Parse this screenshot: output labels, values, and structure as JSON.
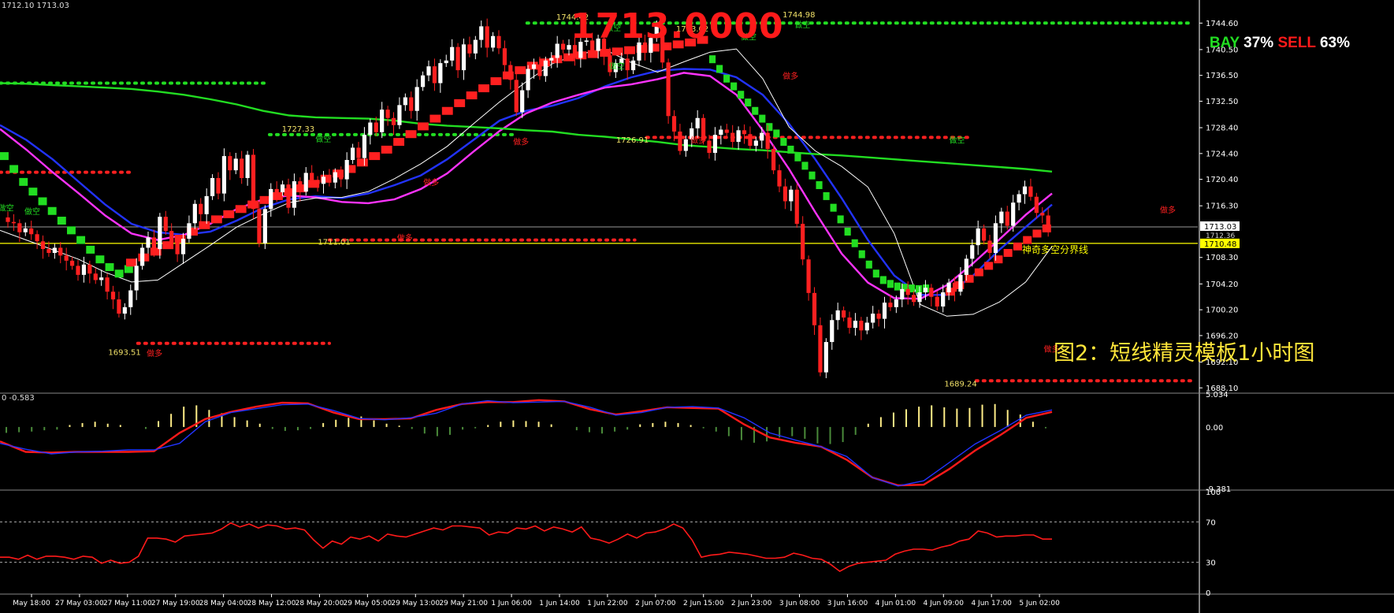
{
  "header": {
    "ohlc_text": "1712.10 1713.03",
    "big_price": "1713.0000",
    "sentiment": {
      "buy_label": "BAY",
      "buy_pct": "37%",
      "sell_label": "SELL",
      "sell_pct": "63%"
    },
    "caption": "图2：短线精灵模板1小时图"
  },
  "colors": {
    "background": "#000000",
    "axis": "#ffffff",
    "up_candle": "#ffffff",
    "down_candle": "#ff2020",
    "green_dots": "#22dd22",
    "red_dots": "#ff2020",
    "ma_blue": "#2233ff",
    "ma_magenta": "#ff33ff",
    "ma_green": "#22dd22",
    "price_line": "#ffff00",
    "macd_red": "#ff1a1a",
    "rsi_red": "#ff1a1a"
  },
  "chart_data": [
    {
      "type": "candlestick",
      "panel": "price",
      "y_ticks": [
        "1744.60",
        "1740.50",
        "1736.50",
        "1732.50",
        "1728.40",
        "1724.40",
        "1720.40",
        "1716.30",
        "1708.30",
        "1704.20",
        "1700.20",
        "1696.20",
        "1692.10",
        "1688.10"
      ],
      "ylim": [
        1687.4,
        1747.2
      ],
      "current_price_tag": "1713.03",
      "bid_tag": "1712.36",
      "line_price_tag": "1710.48",
      "line_price": 1710.48,
      "trend_label": "神奇多空分界线",
      "grid": false,
      "x_ticks": [
        "May 18:00",
        "27 May 03:00",
        "27 May 11:00",
        "27 May 19:00",
        "28 May 04:00",
        "28 May 12:00",
        "28 May 20:00",
        "29 May 05:00",
        "29 May 13:00",
        "29 May 21:00",
        "1 Jun 06:00",
        "1 Jun 14:00",
        "1 Jun 22:00",
        "2 Jun 07:00",
        "2 Jun 15:00",
        "2 Jun 23:00",
        "3 Jun 08:00",
        "3 Jun 16:00",
        "4 Jun 01:00",
        "4 Jun 09:00",
        "4 Jun 17:00",
        "5 Jun 02:00"
      ],
      "close_path": [
        1714.5,
        1713.8,
        1713.6,
        1712.2,
        1712.8,
        1711.9,
        1710.8,
        1709.6,
        1709.0,
        1709.8,
        1708.6,
        1707.8,
        1707.0,
        1705.6,
        1707.2,
        1705.8,
        1704.8,
        1705.2,
        1703.0,
        1701.8,
        1699.6,
        1700.6,
        1703.2,
        1707.0,
        1709.8,
        1711.4,
        1709.6,
        1714.6,
        1712.4,
        1710.6,
        1708.8,
        1711.2,
        1713.6,
        1716.6,
        1715.0,
        1717.8,
        1720.6,
        1718.2,
        1724.0,
        1721.8,
        1723.6,
        1720.6,
        1724.2,
        1715.8,
        1710.5,
        1715.8,
        1718.9,
        1718.4,
        1719.6,
        1716.0,
        1720.1,
        1718.5,
        1721.4,
        1720.3,
        1719.7,
        1720.8,
        1719.9,
        1721.5,
        1720.4,
        1723.4,
        1725.3,
        1723.7,
        1727.3,
        1729.2,
        1727.7,
        1731.2,
        1729.9,
        1728.8,
        1731.9,
        1733.1,
        1731.0,
        1734.7,
        1736.5,
        1737.9,
        1735.3,
        1738.4,
        1738.8,
        1740.9,
        1737.3,
        1741.3,
        1739.9,
        1742.0,
        1744.1,
        1740.8,
        1742.6,
        1740.7,
        1738.1,
        1735.8,
        1730.8,
        1734.2,
        1737.5,
        1738.2,
        1736.4,
        1738.8,
        1739.2,
        1741.4,
        1740.5,
        1741.2,
        1739.2,
        1741.7,
        1741.9,
        1740.3,
        1742.2,
        1739.6,
        1737.0,
        1738.4,
        1739.1,
        1737.3,
        1738.8,
        1741.6,
        1740.0,
        1742.3,
        1744.1,
        1738.5,
        1730.2,
        1727.8,
        1724.8,
        1726.6,
        1728.3,
        1729.9,
        1726.4,
        1724.5,
        1727.3,
        1728.1,
        1727.6,
        1726.2,
        1728.0,
        1727.4,
        1725.6,
        1726.4,
        1727.6,
        1725.1,
        1721.8,
        1719.3,
        1717.0,
        1718.8,
        1713.5,
        1708.0,
        1702.8,
        1697.8,
        1690.5,
        1695.2,
        1698.6,
        1700.1,
        1699.0,
        1697.4,
        1698.5,
        1697.0,
        1698.2,
        1699.6,
        1698.8,
        1701.3,
        1700.6,
        1701.8,
        1703.4,
        1702.5,
        1701.4,
        1702.9,
        1703.6,
        1702.2,
        1700.7,
        1702.9,
        1704.4,
        1703.0,
        1705.6,
        1708.1,
        1710.2,
        1712.8,
        1710.9,
        1709.0,
        1713.6,
        1715.4,
        1713.2,
        1716.8,
        1718.1,
        1719.3,
        1717.7,
        1715.2,
        1714.8,
        1713.03
      ],
      "series": [
        {
          "name": "MA-blue",
          "color": "#2233ff",
          "y": [
            1728.8,
            1726.5,
            1723.5,
            1720.0,
            1716.5,
            1713.5,
            1712.2,
            1711.8,
            1712.3,
            1714.0,
            1716.0,
            1717.3,
            1717.8,
            1717.5,
            1718.2,
            1719.5,
            1721.0,
            1723.5,
            1726.5,
            1729.5,
            1731.0,
            1731.8,
            1733.0,
            1734.8,
            1736.2,
            1737.2,
            1737.5,
            1737.4,
            1736.2,
            1733.5,
            1729.0,
            1723.5,
            1717.5,
            1711.0,
            1705.5,
            1702.5,
            1702.5,
            1705.5,
            1709.5,
            1713.0,
            1716.5
          ]
        },
        {
          "name": "MA-magenta",
          "color": "#ff33ff",
          "y": [
            1728.2,
            1725.0,
            1721.5,
            1718.2,
            1714.8,
            1712.0,
            1711.0,
            1711.8,
            1713.5,
            1715.8,
            1717.3,
            1717.9,
            1717.6,
            1716.9,
            1716.7,
            1717.3,
            1718.9,
            1721.3,
            1724.7,
            1727.9,
            1730.6,
            1732.3,
            1733.5,
            1734.6,
            1735.1,
            1735.9,
            1736.9,
            1736.4,
            1733.5,
            1728.0,
            1722.0,
            1715.3,
            1708.9,
            1704.4,
            1702.0,
            1701.9,
            1704.0,
            1707.4,
            1711.1,
            1714.9,
            1718.2
          ]
        },
        {
          "name": "MA-green-long",
          "color": "#22dd22",
          "y": [
            1735.3,
            1735.2,
            1735.0,
            1734.8,
            1734.6,
            1734.4,
            1734.0,
            1733.5,
            1732.8,
            1732.0,
            1731.0,
            1730.3,
            1730.0,
            1729.9,
            1729.8,
            1729.5,
            1729.0,
            1728.7,
            1728.5,
            1728.3,
            1728.0,
            1727.8,
            1727.3,
            1727.0,
            1726.6,
            1726.2,
            1725.7,
            1725.4,
            1725.1,
            1724.9,
            1724.6,
            1724.3,
            1724.1,
            1723.8,
            1723.5,
            1723.2,
            1722.9,
            1722.6,
            1722.3,
            1722.0,
            1721.6
          ]
        },
        {
          "name": "MA-thin-white",
          "color": "#ffffff",
          "y": [
            1712.5,
            1711.0,
            1709.5,
            1708.0,
            1706.0,
            1704.5,
            1704.8,
            1707.5,
            1710.2,
            1713.0,
            1715.0,
            1716.8,
            1717.5,
            1717.6,
            1718.5,
            1720.5,
            1722.8,
            1725.5,
            1729.0,
            1732.4,
            1735.5,
            1738.3,
            1739.8,
            1740.5,
            1738.5,
            1737.0,
            1738.6,
            1740.1,
            1740.6,
            1736.0,
            1728.5,
            1724.8,
            1722.4,
            1719.2,
            1712.0,
            1701.0,
            1699.2,
            1699.5,
            1701.4,
            1704.5,
            1710.0
          ]
        }
      ],
      "green_step_line": [
        1724,
        1722,
        1720,
        1718.5,
        1717,
        1715.5,
        1714,
        1712.5,
        1711,
        1709.5,
        1708,
        1706.8,
        1705.8,
        1706.5,
        1707.5,
        1709.3,
        1711,
        1712.5,
        1714,
        1715.3,
        1716.5,
        1717.8,
        1718.8,
        1719.8,
        1720.5,
        1721.3,
        1722,
        1722.8,
        1723.5,
        1724.3,
        1725,
        1726,
        1727,
        1728.5,
        1730,
        1731.5,
        1732.8,
        1734,
        1735.5,
        1736.8,
        1738,
        1739.2,
        1740,
        1740.5,
        1740.8,
        1741,
        1741.2,
        1741,
        1740.8,
        1740.7,
        1740.5,
        1739,
        1737.5,
        1736,
        1734.8,
        1733.5,
        1732.3,
        1731,
        1729.8,
        1728.5,
        1727.5,
        1726.2,
        1725,
        1723.8,
        1722.5,
        1721,
        1719.5,
        1717.8,
        1716,
        1714.2,
        1712.3,
        1710.5,
        1708.8,
        1707.2,
        1705.8,
        1704.8,
        1704.2,
        1703.8,
        1703.6,
        1703.5,
        1703.4,
        1703.5
      ],
      "red_step_line": [
        1707.5,
        1708.3,
        1709.2,
        1710.2,
        1711.2,
        1712.3,
        1713.3,
        1714.2,
        1715,
        1715.8,
        1716.5,
        1717.2,
        1717.8,
        1718.4,
        1719,
        1719.7,
        1720.5,
        1721.3,
        1722,
        1723,
        1724,
        1725,
        1726.2,
        1727.4,
        1728.6,
        1729.8,
        1731,
        1732.2,
        1733.4,
        1734.5,
        1735.6,
        1736.5,
        1737.3,
        1738,
        1738.5,
        1739,
        1739.3,
        1739.6,
        1739.8,
        1740,
        1740.2,
        1740.4,
        1740.6,
        1740.8,
        1741,
        1741.3,
        1741.6,
        1742
      ],
      "red_step_line_2": [
        1703,
        1704,
        1705,
        1706,
        1707,
        1708,
        1709,
        1710,
        1711,
        1712,
        1712.8
      ],
      "green_dot_levels": [
        {
          "y": 1735.3,
          "x0": 0.0,
          "x1": 0.225,
          "color": "#22dd22"
        },
        {
          "y": 1727.33,
          "x0": 0.225,
          "x1": 0.43,
          "color": "#22dd22"
        },
        {
          "y": 1744.6,
          "x0": 0.44,
          "x1": 0.995,
          "color": "#22dd22"
        }
      ],
      "red_dot_levels": [
        {
          "y": 1721.5,
          "x0": 0.0,
          "x1": 0.11,
          "color": "#ff2020"
        },
        {
          "y": 1695.0,
          "x0": 0.115,
          "x1": 0.275,
          "color": "#ff2020"
        },
        {
          "y": 1711.0,
          "x0": 0.275,
          "x1": 0.53,
          "color": "#ff2020"
        },
        {
          "y": 1726.9,
          "x0": 0.54,
          "x1": 0.81,
          "color": "#ff2020"
        },
        {
          "y": 1689.2,
          "x0": 0.815,
          "x1": 0.995,
          "color": "#ff2020"
        }
      ],
      "price_labels": [
        {
          "text": "1744.42",
          "x": 0.478,
          "y": 1745.1
        },
        {
          "text": "1744.98",
          "x": 0.667,
          "y": 1745.5
        },
        {
          "text": "1743.02",
          "x": 0.578,
          "y": 1743.3
        },
        {
          "text": "1727.33",
          "x": 0.249,
          "y": 1727.8
        },
        {
          "text": "1726.91",
          "x": 0.528,
          "y": 1726.1
        },
        {
          "text": "1711.01",
          "x": 0.279,
          "y": 1710.3
        },
        {
          "text": "1693.51",
          "x": 0.104,
          "y": 1693.2
        },
        {
          "text": "1689.24",
          "x": 0.802,
          "y": 1688.3
        }
      ],
      "signal_labels": [
        {
          "text": "做空",
          "x": 0.27,
          "y": 1726.2,
          "color": "#22dd22"
        },
        {
          "text": "做空",
          "x": 0.512,
          "y": 1743.4,
          "color": "#22dd22"
        },
        {
          "text": "做空",
          "x": 0.67,
          "y": 1743.9,
          "color": "#22dd22"
        },
        {
          "text": "做空",
          "x": 0.515,
          "y": 1737.5,
          "color": "#22dd22"
        },
        {
          "text": "做空",
          "x": 0.625,
          "y": 1742.0,
          "color": "#22dd22"
        },
        {
          "text": "做空",
          "x": 0.799,
          "y": 1726.0,
          "color": "#22dd22"
        },
        {
          "text": "做空",
          "x": 0.005,
          "y": 1715.5,
          "color": "#22dd22"
        },
        {
          "text": "做空",
          "x": 0.027,
          "y": 1715.0,
          "color": "#22dd22"
        },
        {
          "text": "做多",
          "x": 0.129,
          "y": 1693.0,
          "color": "#ff2020"
        },
        {
          "text": "做多",
          "x": 0.338,
          "y": 1710.9,
          "color": "#ff2020"
        },
        {
          "text": "做多",
          "x": 0.36,
          "y": 1719.5,
          "color": "#ff2020"
        },
        {
          "text": "做多",
          "x": 0.435,
          "y": 1725.8,
          "color": "#ff2020"
        },
        {
          "text": "做多",
          "x": 0.583,
          "y": 1726.0,
          "color": "#ff2020"
        },
        {
          "text": "做多",
          "x": 0.66,
          "y": 1736.0,
          "color": "#ff2020"
        },
        {
          "text": "做多",
          "x": 0.878,
          "y": 1693.7,
          "color": "#ff2020"
        },
        {
          "text": "做多",
          "x": 0.975,
          "y": 1715.2,
          "color": "#ff2020"
        }
      ]
    },
    {
      "type": "line",
      "panel": "macd",
      "label": "0 -0.583",
      "y_ticks": [
        "5.034",
        "0.00",
        "-9.381"
      ],
      "ylim": [
        -9.381,
        5.034
      ],
      "series": [
        {
          "name": "MACD-red",
          "color": "#ff1a1a",
          "y": [
            -2.2,
            -3.8,
            -3.9,
            -3.8,
            -3.8,
            -3.8,
            -3.7,
            -0.9,
            1.2,
            2.3,
            3.1,
            3.7,
            3.6,
            2.2,
            1.2,
            1.2,
            1.3,
            2.6,
            3.5,
            3.8,
            3.8,
            4.1,
            3.9,
            2.7,
            1.9,
            2.4,
            3.0,
            2.9,
            2.8,
            0.4,
            -1.6,
            -2.4,
            -3.0,
            -5.0,
            -7.7,
            -8.9,
            -8.8,
            -6.4,
            -3.6,
            -1.2,
            1.4,
            2.3
          ]
        },
        {
          "name": "Signal-blue",
          "color": "#2233ff",
          "y": [
            -2.5,
            -3.4,
            -4.1,
            -3.8,
            -3.7,
            -3.5,
            -3.5,
            -2.5,
            0.8,
            2.2,
            2.8,
            3.4,
            3.5,
            2.5,
            1.3,
            1.1,
            1.4,
            2.1,
            3.5,
            4.0,
            3.7,
            3.8,
            3.9,
            3.0,
            1.8,
            2.2,
            3.0,
            3.1,
            2.9,
            1.4,
            -0.9,
            -2.0,
            -3.0,
            -4.5,
            -7.7,
            -9.0,
            -8.2,
            -5.4,
            -2.6,
            -0.5,
            1.8,
            2.6
          ]
        }
      ],
      "histogram": [
        -0.9,
        -0.8,
        -0.7,
        -0.5,
        -0.4,
        0.3,
        0.6,
        0.8,
        0.5,
        0.3,
        0.0,
        -0.3,
        0.9,
        2.0,
        3.1,
        3.3,
        2.6,
        2.1,
        1.5,
        1.0,
        0.5,
        -0.3,
        -0.6,
        -0.5,
        -0.3,
        0.6,
        1.1,
        1.4,
        1.6,
        1.0,
        0.5,
        0.2,
        -0.3,
        -1.0,
        -1.4,
        -1.2,
        -0.4,
        -0.2,
        0.3,
        0.8,
        1.0,
        0.9,
        0.8,
        0.4,
        0.0,
        -0.5,
        -0.8,
        -1.0,
        -0.7,
        -0.4,
        0.4,
        0.6,
        0.8,
        0.6,
        0.3,
        -0.2,
        -0.7,
        -1.4,
        -2.0,
        -2.4,
        -2.2,
        -1.6,
        -1.4,
        -1.8,
        -2.5,
        -2.6,
        -2.3,
        -1.2,
        0.5,
        1.5,
        2.2,
        2.7,
        3.1,
        3.3,
        3.0,
        2.8,
        2.9,
        3.4,
        3.5,
        2.6,
        1.9,
        0.8,
        -0.2
      ]
    },
    {
      "type": "line",
      "panel": "rsi",
      "y_ticks": [
        "100",
        "70",
        "30",
        "0"
      ],
      "ylim": [
        0,
        100
      ],
      "levels": [
        70,
        30
      ],
      "series": [
        {
          "name": "RSI-red",
          "color": "#ff1a1a",
          "y": [
            35,
            35,
            33,
            37,
            33,
            36,
            36,
            35,
            33,
            36,
            35,
            29,
            32,
            29,
            30,
            36,
            54,
            54,
            53,
            50,
            56,
            57,
            58,
            59,
            63,
            69,
            65,
            68,
            64,
            67,
            66,
            63,
            64,
            62,
            52,
            44,
            51,
            48,
            55,
            53,
            56,
            51,
            58,
            56,
            55,
            58,
            61,
            64,
            62,
            66,
            66,
            65,
            64,
            57,
            60,
            59,
            64,
            63,
            66,
            61,
            65,
            63,
            60,
            65,
            54,
            52,
            49,
            53,
            58,
            54,
            59,
            60,
            63,
            68,
            64,
            52,
            35,
            37,
            38,
            40,
            39,
            38,
            36,
            34,
            34,
            35,
            39,
            37,
            34,
            33,
            28,
            21,
            26,
            29,
            30,
            31,
            32,
            38,
            41,
            43,
            43,
            42,
            45,
            47,
            51,
            53,
            61,
            59,
            55,
            56,
            56,
            57,
            57,
            53,
            53
          ]
        }
      ]
    }
  ]
}
